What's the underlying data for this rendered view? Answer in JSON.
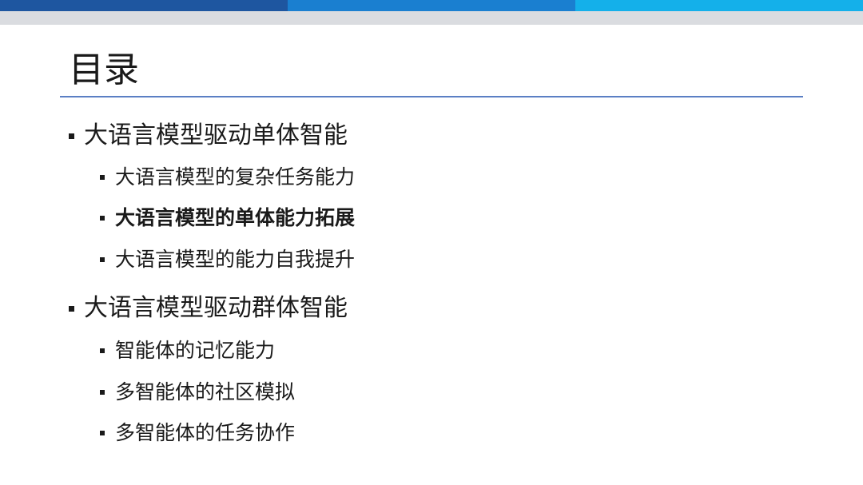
{
  "colors": {
    "bar_segments": [
      "#1e56a0",
      "#1a7fd0",
      "#14b0ea"
    ],
    "bar_gray": "#dadce0",
    "title_rule": "#5b7fc4",
    "text": "#1a1a1a"
  },
  "title": "目录",
  "outline": [
    {
      "label": "大语言模型驱动单体智能",
      "children": [
        {
          "label": "大语言模型的复杂任务能力",
          "bold": false
        },
        {
          "label": "大语言模型的单体能力拓展",
          "bold": true
        },
        {
          "label": "大语言模型的能力自我提升",
          "bold": false
        }
      ]
    },
    {
      "label": "大语言模型驱动群体智能",
      "children": [
        {
          "label": "智能体的记忆能力",
          "bold": false
        },
        {
          "label": "多智能体的社区模拟",
          "bold": false
        },
        {
          "label": "多智能体的任务协作",
          "bold": false
        }
      ]
    }
  ]
}
